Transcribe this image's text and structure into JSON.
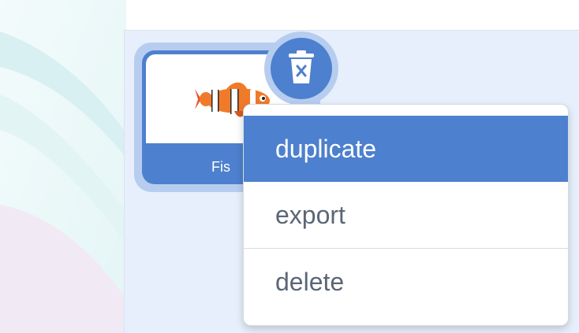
{
  "sprite": {
    "name": "Fis",
    "thumbnail_icon": "clownfish-icon"
  },
  "trash_button": {
    "icon": "trash-icon"
  },
  "context_menu": {
    "items": [
      {
        "label": "duplicate",
        "highlighted": true
      },
      {
        "label": "export",
        "highlighted": false
      },
      {
        "label": "delete",
        "highlighted": false
      }
    ]
  },
  "colors": {
    "accent": "#4d80ce",
    "accent_light": "#b7cdef",
    "pane_background": "#e7effc",
    "menu_text": "#5b6675"
  }
}
